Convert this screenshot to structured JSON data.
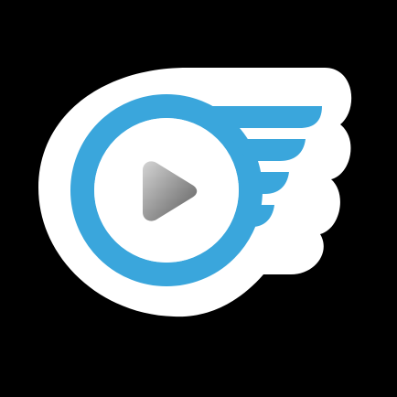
{
  "icon": {
    "name": "winged-play-icon",
    "colors": {
      "background": "#000000",
      "sticker": "#ffffff",
      "brand_blue": "#3aa6dc",
      "play_light": "#d4d4d4",
      "play_dark": "#5d5d5d"
    }
  }
}
